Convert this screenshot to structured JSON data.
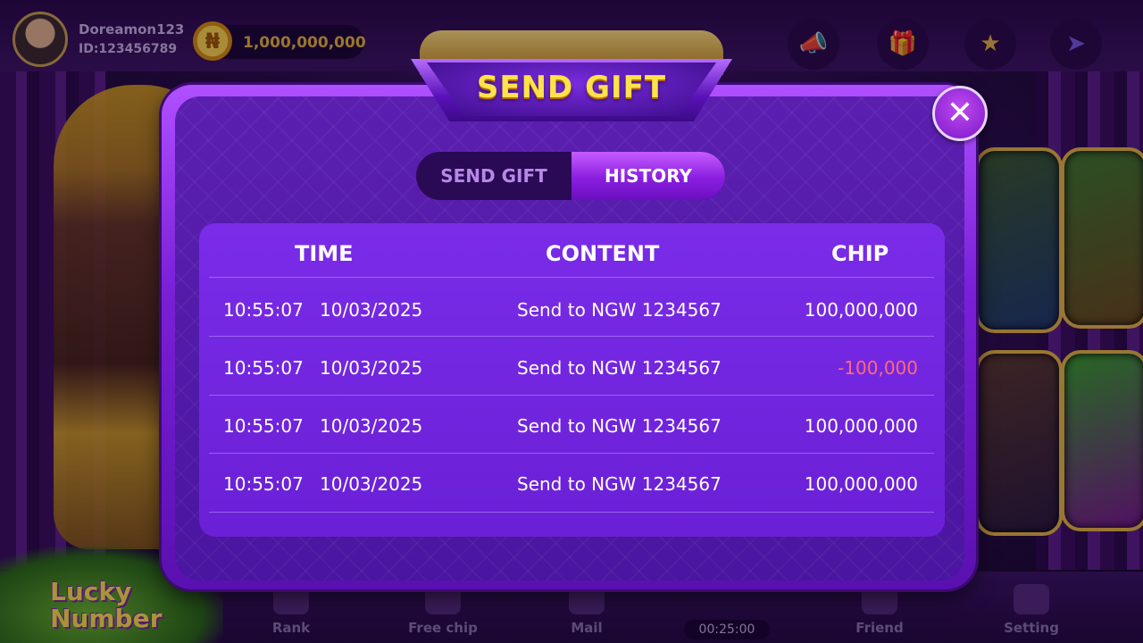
{
  "header": {
    "username": "Doreamon123",
    "user_id": "ID:123456789",
    "coin_symbol": "₦",
    "balance": "1,000,000,000"
  },
  "bottom_nav": {
    "items": [
      {
        "label": "Rank",
        "icon": "trophy-icon"
      },
      {
        "label": "Free chip",
        "icon": "chip-icon"
      },
      {
        "label": "Mail",
        "icon": "mail-icon"
      },
      {
        "label": "Friend",
        "icon": "friends-icon"
      },
      {
        "label": "Setting",
        "icon": "gear-icon"
      }
    ],
    "timer": "00:25:00"
  },
  "modal": {
    "title": "SEND GIFT",
    "close_icon": "close-icon",
    "tabs": [
      {
        "label": "SEND GIFT",
        "active": false
      },
      {
        "label": "HISTORY",
        "active": true
      }
    ],
    "table": {
      "headers": {
        "time": "TIME",
        "content": "CONTENT",
        "chip": "CHIP"
      },
      "rows": [
        {
          "time": "10:55:07",
          "date": "10/03/2025",
          "content": "Send to NGW 1234567",
          "chip": "100,000,000",
          "negative": false
        },
        {
          "time": "10:55:07",
          "date": "10/03/2025",
          "content": "Send to NGW 1234567",
          "chip": "-100,000",
          "negative": true
        },
        {
          "time": "10:55:07",
          "date": "10/03/2025",
          "content": "Send to NGW 1234567",
          "chip": "100,000,000",
          "negative": false
        },
        {
          "time": "10:55:07",
          "date": "10/03/2025",
          "content": "Send to NGW 1234567",
          "chip": "100,000,000",
          "negative": false
        }
      ]
    }
  },
  "colors": {
    "title_gold": "#ffe24a",
    "negative_chip": "#ff6a7a",
    "active_tab": "#8a1ee0",
    "panel": "#6a20d6"
  }
}
